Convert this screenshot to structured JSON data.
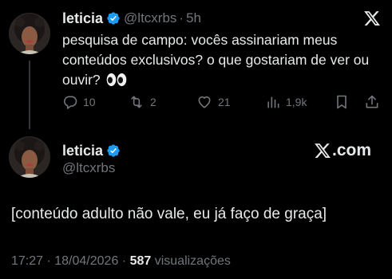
{
  "tweet": {
    "author_name": "leticia",
    "author_handle": "@ltcxrbs",
    "separator": "·",
    "time": "5h",
    "text": "pesquisa de campo: vocês assinariam meus conteúdos exclusivos? o que gostariam de ver ou ouvir?",
    "emoji": "eyes-emoji",
    "stats": {
      "replies": "10",
      "reposts": "2",
      "likes": "21",
      "views": "1,9k"
    }
  },
  "reply": {
    "author_name": "leticia",
    "author_handle": "@ltcxrbs",
    "brand": ".com",
    "text": "[conteúdo adulto não vale, eu já faço de graça]",
    "timestamp": "17:27 · 18/04/2026 · ",
    "views_count": "587",
    "views_label": " visualizações"
  },
  "colors": {
    "background": "#000000",
    "text": "#e7e9ea",
    "muted": "#71767b",
    "verified": "#1d9bf0"
  },
  "icons": [
    "verified-icon",
    "x-logo-icon",
    "reply-icon",
    "repost-icon",
    "like-icon",
    "views-icon",
    "bookmark-icon",
    "share-icon"
  ]
}
